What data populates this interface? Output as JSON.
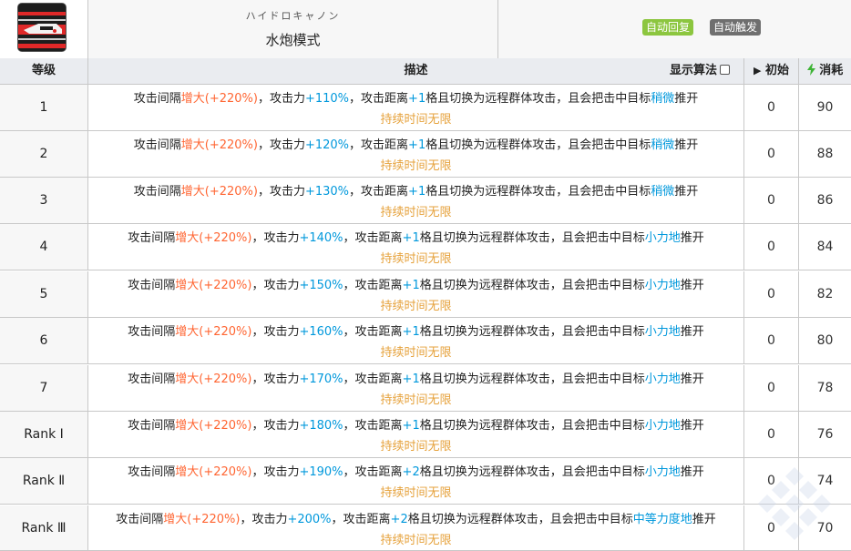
{
  "skill": {
    "name_jp": "ハイドロキャノン",
    "name_cn": "水炮模式",
    "tags": [
      "自动回复",
      "自动触发"
    ],
    "icon": "hydro-cannon-skill-icon"
  },
  "columns": {
    "level": "等级",
    "desc": "描述",
    "toggle_label": "显示算法",
    "init": "初始",
    "cost": "消耗",
    "init_icon": "play-triangle-icon",
    "cost_icon": "lightning-icon"
  },
  "colors": {
    "orange": "#ff6633",
    "blue": "#0098dc",
    "gold": "#e6a23c",
    "tag_green": "#8cc63f",
    "tag_gray": "#6f6f6f",
    "cost_icon": "#3db335"
  },
  "rows": [
    {
      "level": "1",
      "p1": "攻击间隔",
      "p2": "增大(+220%)",
      "p3": "，攻击力",
      "p4": "+110%",
      "p5": "，攻击距离",
      "p6": "+1",
      "p7": "格且切换为远程群体攻击，且会把击中目标",
      "p8": "稍微",
      "p9": "推开",
      "line2": "持续时间无限",
      "init": "0",
      "cost": "90"
    },
    {
      "level": "2",
      "p1": "攻击间隔",
      "p2": "增大(+220%)",
      "p3": "，攻击力",
      "p4": "+120%",
      "p5": "，攻击距离",
      "p6": "+1",
      "p7": "格且切换为远程群体攻击，且会把击中目标",
      "p8": "稍微",
      "p9": "推开",
      "line2": "持续时间无限",
      "init": "0",
      "cost": "88"
    },
    {
      "level": "3",
      "p1": "攻击间隔",
      "p2": "增大(+220%)",
      "p3": "，攻击力",
      "p4": "+130%",
      "p5": "，攻击距离",
      "p6": "+1",
      "p7": "格且切换为远程群体攻击，且会把击中目标",
      "p8": "稍微",
      "p9": "推开",
      "line2": "持续时间无限",
      "init": "0",
      "cost": "86"
    },
    {
      "level": "4",
      "p1": "攻击间隔",
      "p2": "增大(+220%)",
      "p3": "，攻击力",
      "p4": "+140%",
      "p5": "，攻击距离",
      "p6": "+1",
      "p7": "格且切换为远程群体攻击，且会把击中目标",
      "p8": "小力地",
      "p9": "推开",
      "line2": "持续时间无限",
      "init": "0",
      "cost": "84"
    },
    {
      "level": "5",
      "p1": "攻击间隔",
      "p2": "增大(+220%)",
      "p3": "，攻击力",
      "p4": "+150%",
      "p5": "，攻击距离",
      "p6": "+1",
      "p7": "格且切换为远程群体攻击，且会把击中目标",
      "p8": "小力地",
      "p9": "推开",
      "line2": "持续时间无限",
      "init": "0",
      "cost": "82"
    },
    {
      "level": "6",
      "p1": "攻击间隔",
      "p2": "增大(+220%)",
      "p3": "，攻击力",
      "p4": "+160%",
      "p5": "，攻击距离",
      "p6": "+1",
      "p7": "格且切换为远程群体攻击，且会把击中目标",
      "p8": "小力地",
      "p9": "推开",
      "line2": "持续时间无限",
      "init": "0",
      "cost": "80"
    },
    {
      "level": "7",
      "p1": "攻击间隔",
      "p2": "增大(+220%)",
      "p3": "，攻击力",
      "p4": "+170%",
      "p5": "，攻击距离",
      "p6": "+1",
      "p7": "格且切换为远程群体攻击，且会把击中目标",
      "p8": "小力地",
      "p9": "推开",
      "line2": "持续时间无限",
      "init": "0",
      "cost": "78"
    },
    {
      "level": "Rank Ⅰ",
      "p1": "攻击间隔",
      "p2": "增大(+220%)",
      "p3": "，攻击力",
      "p4": "+180%",
      "p5": "，攻击距离",
      "p6": "+1",
      "p7": "格且切换为远程群体攻击，且会把击中目标",
      "p8": "小力地",
      "p9": "推开",
      "line2": "持续时间无限",
      "init": "0",
      "cost": "76"
    },
    {
      "level": "Rank Ⅱ",
      "p1": "攻击间隔",
      "p2": "增大(+220%)",
      "p3": "，攻击力",
      "p4": "+190%",
      "p5": "，攻击距离",
      "p6": "+2",
      "p7": "格且切换为远程群体攻击，且会把击中目标",
      "p8": "小力地",
      "p9": "推开",
      "line2": "持续时间无限",
      "init": "0",
      "cost": "74"
    },
    {
      "level": "Rank Ⅲ",
      "p1": "攻击间隔",
      "p2": "增大(+220%)",
      "p3": "，攻击力",
      "p4": "+200%",
      "p5": "，攻击距离",
      "p6": "+2",
      "p7": "格且切换为远程群体攻击，且会把击中目标",
      "p8": "中等力度地",
      "p9": "推开",
      "line2": "持续时间无限",
      "init": "0",
      "cost": "70"
    }
  ]
}
